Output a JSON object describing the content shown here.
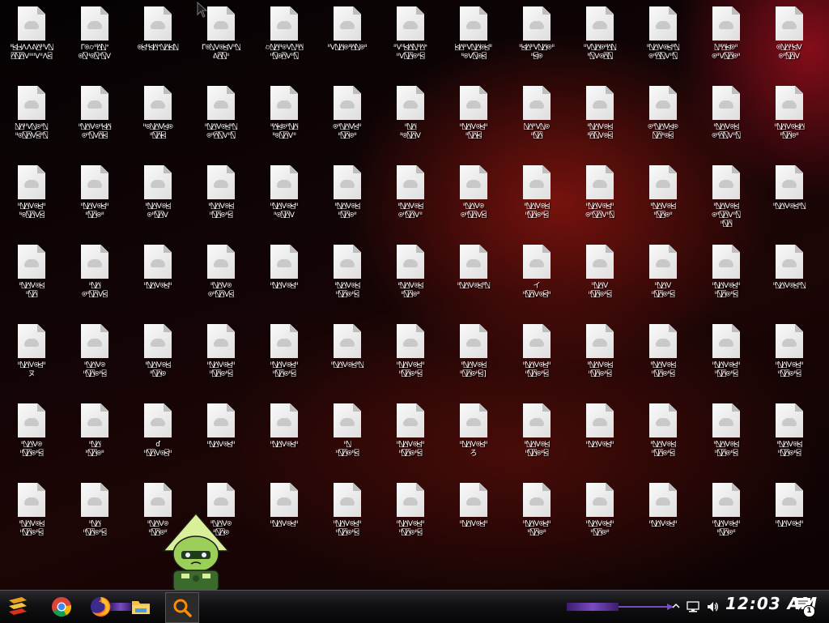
{
  "desktop": {
    "columns": 13,
    "rows": 7,
    "icon_type": "blank-document-icon",
    "labels": [
      [
        "ᐦ⍃⍈ᐰᐱᕕ⍓ᐦᐯ⍂\n⍓⍂⍓ᐯᐦᐦᐯᐦᐱ⍃",
        "ᒥ⍟⌭ᐦ⍓⍂ᐤ\n⍟⍂ᐦ⍟⍂ᐦ⍂ᐯ",
        "⍟⍃ᐦ⍃⍓ᐤ⍂⍓⍃⍂",
        "ᒥ⍟⍂ᐯ⍟⍃ᐯᐦ⍂\nᕕ⍓⍂ᐦ",
        "⌭⍂⍓ᐦ⍟ᐯ⍂ᐦ⍓\nᐦ⍂⍟⍓ᐯᐦ⍂",
        "ᐦᐯ⍂⍓⍟ᐦ⍓⍂⍟ᐦ",
        "ᐦᐯᐦ⍃⍓⍂ᐦ⍓ᐤ\nᐦᐯ⍂⍓⍟ᐦ⍃",
        "⍃⍓ᐦᐯ⍂⍓⍟⍃ᐦ\nᐦ⍟ᐯ⍂⍟⍃",
        "ᐦ⍃⍓ᐦᐯ⍂⍓⍟ᐦ\nᐦ⍃⍟",
        "ᐦᐯ⍂⍓⍟ᐦ⍓⍂\nᐦ⍂ᐯ⍟⍓⍂",
        "ᐦ⍂⍓ᐯ⍟⍃ᐦ⍂\n⍟ᐦ⍓⍂ᐯᐦ⍂",
        "⍂ᐦ⍓⍃⍟ᐦ\n⍟ᐦᐯ⍂⍓⍟ᐦ",
        "⍟⍂⍓ᐦ⍃ᐯ\n⍟ᐦ⍂⍓ᐯ"
      ],
      [
        "⍂⍓ᐦᐯ⍂⍟ᐦ⍂\nᐦ⍟⍂⍓ᐯ⍃ᐦ⍂",
        "ᐦ⍂⍓ᐯ⍟ᐦ⍃⍓\n⍟ᐦ⍂ᐯ⍓⍃",
        "ᐦ⍟⍂⍓ᐯ⍃⍟\nᐦ⍂⍓⍃",
        "ᐦ⍂⍓ᐯ⍟⍃ᐦ⍂\n⍟ᐦ⍓⍂ᐯᐦ⍂",
        "ᐦ⍓⍃⍟ᐦ⍂⍓\nᐦ⍟⍂⍓ᐯᐦ",
        "⍟ᐦ⍂⍓ᐯ⍃ᐦ\nᐦ⍂⍓⍟ᐦ",
        "ᐦ⍂⍓\nᐦ⍟⍂⍓ᐯ",
        "ᐦ⍂⍓ᐯ⍟⍃ᐦ\nᐦ⍂⍓⍃",
        "⍂⍓ᐦᐯ⍂⍟\nᐦ⍂⍓",
        "ᐦ⍂⍓ᐯ⍟⍃\nᐦ⍓⍂ᐯ⍟⍃",
        "⍟ᐦ⍂⍓ᐯ⍃⍟\n⍂⍓ᐦ⍟⍃",
        "ᐦ⍂⍓ᐯ⍟⍃\n⍟ᐦ⍓⍂ᐯᐦ⍂",
        "ᐦ⍂⍓ᐯ⍟⍃⍓\nᐦ⍂⍓⍟ᐦ"
      ],
      [
        "ᐦ⍂⍓ᐯ⍟⍃ᐦ\nᐦ⍟⍂⍓ᐯ⍃",
        "ᐦ⍂⍓ᐯ⍟⍃ᐦ\nᐦ⍂⍓⍟ᐦ",
        "ᐦ⍂⍓ᐯ⍟⍃\n⍟ᐦ⍂⍓ᐯ",
        "ᐦ⍂⍓ᐯ⍟⍃\nᐦ⍂⍓⍟ᐦ⍃",
        "ᐦ⍂⍓ᐯ⍟⍃ᐦ\nᐦ⍟⍂⍓ᐯ",
        "ᐦ⍂⍓ᐯ⍟⍃\nᐦ⍂⍓⍟ᐦ",
        "ᐦ⍂⍓ᐯ⍟⍃\n⍟ᐦ⍂⍓ᐯᐦ",
        "ᐦ⍂⍓ᐯ⍟\n⍟ᐦ⍂⍓ᐯ⍃",
        "ᐦ⍂⍓ᐯ⍟⍃\nᐦ⍂⍓⍟ᐦ⍃",
        "ᐦ⍂⍓ᐯ⍟⍃ᐦ\n⍟ᐦ⍂⍓ᐯᐦ⍂",
        "ᐦ⍂⍓ᐯ⍟⍃\nᐦ⍂⍓⍟ᐦ",
        "ᐦ⍂⍓ᐯ⍟⍃\n⍟ᐦ⍂⍓ᐯᐦ⍂\nᐦ⍂⍓",
        "ᐦ⍂⍓ᐯ⍟⍃ᐦ⍂"
      ],
      [
        "ᐦ⍂⍓ᐯ⍟⍃\nᐦ⍂⍓",
        "ᐦ⍂⍓\n⍟ᐦ⍂⍓ᐯ⍃",
        "ᐦ⍂⍓ᐯ⍟⍃ᐦ",
        "ᐦ⍂⍓ᐯ⍟\n⍟ᐦ⍂⍓ᐯ⍃",
        "ᐦ⍂⍓ᐯ⍟⍃ᐦ",
        "ᐦ⍂⍓ᐯ⍟⍃\nᐦ⍂⍓⍟ᐦ⍃",
        "ᐦ⍂⍓ᐯ⍟⍃\nᐦ⍂⍓⍟ᐦ",
        "ᐦ⍂⍓ᐯ⍟⍃ᐦ⍂",
        "イ\nᐦ⍂⍓ᐯ⍟⍃ᐦ",
        "ᐦ⍂⍓ᐯ\nᐦ⍂⍓⍟ᐦ⍃",
        "ᐦ⍂⍓ᐯ\nᐦ⍂⍓⍟ᐦ⍃",
        "ᐦ⍂⍓ᐯ⍟⍃ᐦ\nᐦ⍂⍓⍟ᐦ⍃",
        "ᐦ⍂⍓ᐯ⍟⍃ᐦ⍂"
      ],
      [
        "ᐦ⍂⍓ᐯ⍟⍃ᐦ\nヌ",
        "ᐦ⍂⍓ᐯ⍟\nᐦ⍂⍓⍟ᐦ⍃",
        "ᐦ⍂⍓ᐯ⍟⍃\nᐦ⍂⍓⍟",
        "ᐦ⍂⍓ᐯ⍟⍃ᐦ\nᐦ⍂⍓⍟ᐦ⍃",
        "ᐦ⍂⍓ᐯ⍟⍃ᐦ\nᐦ⍂⍓⍟ᐦ⍃",
        "ᐦ⍂⍓ᐯ⍟⍃ᐦ⍂",
        "ᐦ⍂⍓ᐯ⍟⍃ᐦ\nᐦ⍂⍓⍟ᐦ⍃",
        "ᐦ⍂⍓ᐯ⍟⍃\nᐦ⍂⍓⍟ᐦ⍃]",
        "ᐦ⍂⍓ᐯ⍟⍃ᐦ\nᐦ⍂⍓⍟ᐦ⍃",
        "ᐦ⍂⍓ᐯ⍟⍃\nᐦ⍂⍓⍟ᐦ⍃",
        "ᐦ⍂⍓ᐯ⍟⍃\nᐦ⍂⍓⍟ᐦ⍃",
        "ᐦ⍂⍓ᐯ⍟⍃ᐦ\nᐦ⍂⍓⍟ᐦ⍃",
        "ᐦ⍂⍓ᐯ⍟⍃ᐦ\nᐦ⍂⍓⍟ᐦ⍃"
      ],
      [
        "ᐦ⍂⍓ᐯ⍟\nᐦ⍂⍓⍟ᐦ⍃",
        "ᐦ⍂⍓\nᐦ⍂⍓⍟ᐦ",
        "ď\nᐦ⍂⍓ᐯ⍟⍃ᐦ",
        "ᐦ⍂⍓ᐯ⍟⍃ᐦ",
        "ᐦ⍂⍓ᐯ⍟⍃ᐦ",
        "ᐦ⍂\nᐦ⍂⍓⍟ᐦ⍃",
        "ᐦ⍂⍓ᐯ⍟⍃ᐦ\nᐦ⍂⍓⍟ᐦ⍃",
        "ᐦ⍂⍓ᐯ⍟⍃ᐦ\nろ",
        "ᐦ⍂⍓ᐯ⍟⍃\nᐦ⍂⍓⍟ᐦ⍃",
        "ᐦ⍂⍓ᐯ⍟⍃ᐦ",
        "ᐦ⍂⍓ᐯ⍟⍃\nᐦ⍂⍓⍟ᐦ⍃",
        "ᐦ⍂⍓ᐯ⍟⍃\nᐦ⍂⍓⍟ᐦ⍃",
        "ᐦ⍂⍓ᐯ⍟⍃\nᐦ⍂⍓⍟ᐦ⍃"
      ],
      [
        "ᐦ⍂⍓ᐯ⍟⍃\nᐦ⍂⍓⍟ᐦ⍃",
        "ᐦ⍂⍓\nᐦ⍂⍓⍟ᐦ⍃",
        "ᐦ⍂⍓ᐯ⍟\nᐦ⍂⍓⍟ᐦ",
        "ᐦ⍂⍓ᐯ⍟\nᐦ⍂⍓⍟",
        "ᐦ⍂⍓ᐯ⍟⍃ᐦ",
        "ᐦ⍂⍓ᐯ⍟⍃ᐦ\nᐦ⍂⍓⍟ᐦ⍃",
        "ᐦ⍂⍓ᐯ⍟⍃ᐦ\nᐦ⍂⍓⍟ᐦ⍃",
        "ᐦ⍂⍓ᐯ⍟⍃ᐦ",
        "ᐦ⍂⍓ᐯ⍟⍃ᐦ\nᐦ⍂⍓⍟ᐦ",
        "ᐦ⍂⍓ᐯ⍟⍃ᐦ\nᐦ⍂⍓⍟ᐦ",
        "ᐦ⍂⍓ᐯ⍟⍃ᐦ",
        "ᐦ⍂⍓ᐯ⍟⍃ᐦ\nᐦ⍂⍓⍟ᐦ",
        "ᐦ⍂⍓ᐯ⍟⍃ᐦ"
      ]
    ]
  },
  "taskbar": {
    "start_icon": "start-logo-icon",
    "pinned": [
      {
        "name": "chrome-icon"
      },
      {
        "name": "firefox-icon"
      },
      {
        "name": "file-explorer-icon"
      },
      {
        "name": "search-icon"
      }
    ],
    "tray": {
      "network_icon": "network-icon",
      "volume_icon": "volume-icon",
      "clock": "12:03 AM",
      "notifications_icon": "notification-icon",
      "notifications_count": "1"
    },
    "accent_color": "#7a4bc0"
  }
}
